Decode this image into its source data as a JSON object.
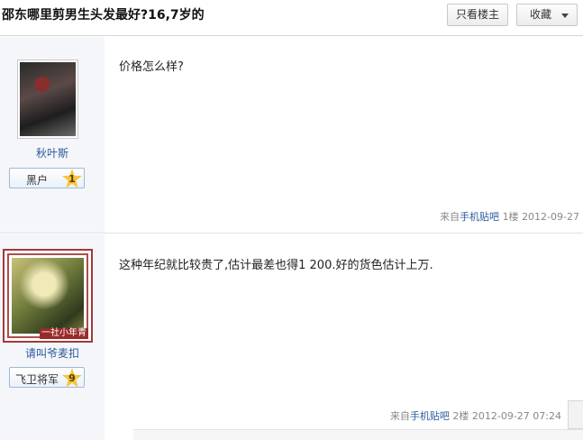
{
  "header": {
    "title": "邵东哪里剪男生头发最好?16,7岁的",
    "only_op_label": "只看楼主",
    "favorite_label": "收藏"
  },
  "posts": [
    {
      "username": "秋叶斯",
      "badge_label": "黑户",
      "level": "1",
      "content": "价格怎么样?",
      "source_prefix": "来自",
      "source": "手机贴吧",
      "floor": "1楼",
      "time": "2012-09-27"
    },
    {
      "username": "请叫爷麦扣",
      "badge_label": "飞卫将军",
      "level": "9",
      "avatar_tag": "一社小年青",
      "content": "这种年纪就比较贵了,估计最差也得1 200.好的货色估计上万.",
      "source_prefix": "来自",
      "source": "手机贴吧",
      "floor": "2楼",
      "time": "2012-09-27 07:24"
    }
  ],
  "colors": {
    "link": "#2a5a9c",
    "sidebar_bg": "#f4f6f9",
    "avatar_border": "#a23a3a",
    "level_star": "#f5c638"
  }
}
